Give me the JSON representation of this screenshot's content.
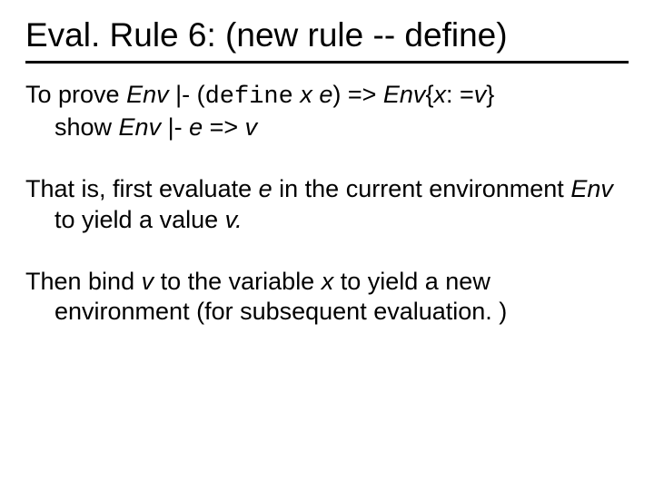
{
  "title": "Eval. Rule 6: (new rule -- define)",
  "p1": {
    "prefix": "To prove ",
    "env1": "Env",
    "mid1": " |- (",
    "define": "define",
    "space1": " ",
    "x1": "x",
    "space2": " ",
    "e1": "e",
    "close1": ") => ",
    "env2": "Env",
    "brace_open": "{",
    "x2": "x",
    "assign": ": =",
    "v1": "v",
    "brace_close": "}",
    "line2_prefix": "show ",
    "env3": "Env",
    "line2_mid": " |- ",
    "e2": "e",
    "line2_arrow": " => ",
    "v2": "v"
  },
  "p2": {
    "t1": "That is, first evaluate ",
    "e": "e",
    "t2": " in the current environment ",
    "env": "Env",
    "t3": " to yield a value ",
    "v": "v",
    "t4": "."
  },
  "p3": {
    "t1": "Then bind ",
    "v": "v",
    "t2": " to the variable ",
    "x": "x",
    "t3": " to yield a new environment (for subsequent evaluation. )"
  }
}
